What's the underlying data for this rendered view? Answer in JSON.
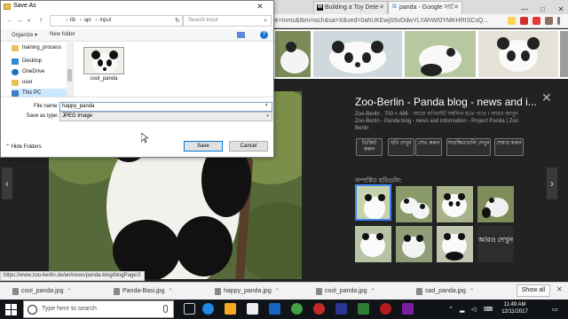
{
  "browser": {
    "tabs": [
      {
        "label": "Building a Toy Dete",
        "icon": "medium-icon"
      },
      {
        "label": "panda - Google সার্চ",
        "icon": "google-icon"
      }
    ],
    "url": "ie=Inms&tbm=isch&sa=X&ved=0ahUKEwjS5vDdwYLYAhWI0YMKHRISCsQ...",
    "window_controls": [
      "—",
      "□",
      "✕"
    ]
  },
  "viewer": {
    "title": "Zoo-Berlin - Panda blog - news and i...",
    "subtitle": "Zoo-Berlin · 700 × 486 · আরো কপিরাইট সম্বলিত হতে পারে । আরও জানুন",
    "description": "Zoo-Berlin - Panda blog - news and information - Project Panda | Zoo Berlin",
    "actions": [
      {
        "label": "ভিজিট করুন"
      },
      {
        "label": "ছবি দেখুন"
      },
      {
        "label": "সেভ করুন"
      },
      {
        "label": "সংরক্ষিতগুলি দেখুন"
      },
      {
        "label": "শেয়ার করুন"
      }
    ],
    "related_label": "সম্পর্কিত ছবিগুলি:",
    "more_label": "আরও দেখুন"
  },
  "status_bar": {
    "text": "https://www.zoo-berlin.de/en/news/panda-blog/blogPage/2"
  },
  "downloads": {
    "items": [
      "cool_panda.jpg",
      "Panda-Basi.jpg",
      "happy_panda.jpg",
      "cool_panda.jpg",
      "sad_panda.jpg"
    ],
    "show_all_label": "Show all"
  },
  "taskbar": {
    "search_placeholder": "Type here to search",
    "time": "11:49 AM",
    "date": "12/11/2017"
  },
  "dialog": {
    "title": "Save As",
    "path": [
      "lib",
      "api",
      "input"
    ],
    "search_placeholder": "Search input",
    "organize_label": "Organize",
    "new_folder_label": "New folder",
    "nav_items": [
      "training_process",
      "Desktop",
      "OneDrive",
      "user",
      "This PC"
    ],
    "selected_nav": "This PC",
    "files": [
      {
        "name": "cool_panda"
      }
    ],
    "file_name_label": "File name:",
    "file_name_value": "happy_panda",
    "save_as_type_label": "Save as type:",
    "save_as_type_value": "JPEG Image",
    "hide_folders_label": "Hide Folders",
    "save_label": "Save",
    "cancel_label": "Cancel"
  },
  "colors": {
    "accent": "#0078d7",
    "viewer_bg": "#222222",
    "selection": "#cce8ff"
  }
}
